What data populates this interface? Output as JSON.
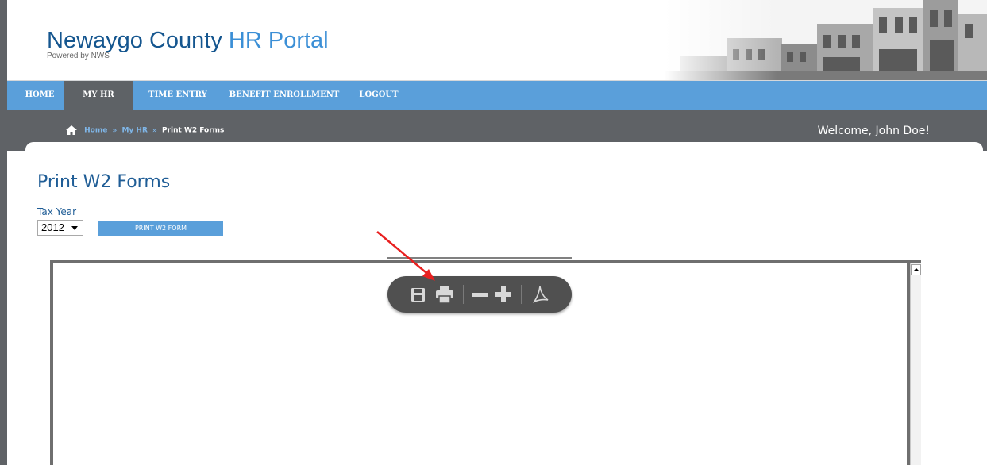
{
  "header": {
    "title_main": "Newaygo County",
    "title_accent": "HR Portal",
    "subtitle": "Powered by NWS"
  },
  "nav": {
    "items": [
      {
        "label": "HOME"
      },
      {
        "label": "MY HR"
      },
      {
        "label": "TIME ENTRY"
      },
      {
        "label": "BENEFIT ENROLLMENT"
      },
      {
        "label": "LOGOUT"
      }
    ],
    "active": "MY HR"
  },
  "breadcrumb": {
    "home": "Home",
    "separator": "»",
    "parent": "My HR",
    "current": "Print W2 Forms"
  },
  "welcome": "Welcome, John Doe!",
  "main": {
    "title": "Print W2 Forms",
    "tax_year_label": "Tax Year",
    "tax_year_value": "2012",
    "print_button_label": "PRINT W2 FORM"
  },
  "pdf_toolbar": {
    "buttons": [
      "save-icon",
      "print-icon",
      "zoom-out-icon",
      "zoom-in-icon",
      "adobe-acrobat-icon"
    ]
  },
  "colors": {
    "nav_background": "#5a9fda",
    "nav_active": "#5e6266",
    "subbar": "#5f6266",
    "title_blue": "#1f5d96",
    "accent_blue": "#3b8fd6",
    "annotation_arrow": "#e81f1f"
  }
}
